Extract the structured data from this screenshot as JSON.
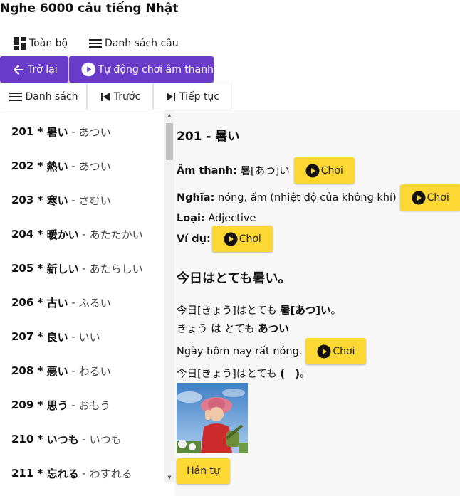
{
  "app": {
    "title": "Nghe 6000 câu tiếng Nhật"
  },
  "view_toggle": {
    "all_label": "Toàn bộ",
    "list_label": "Danh sách câu"
  },
  "nav": {
    "back_label": "Trở lại",
    "autoplay_label": "Tự động chơi âm thanh"
  },
  "tabs": {
    "list_label": "Danh sách",
    "prev_label": "Trước",
    "next_label": "Tiếp tục"
  },
  "sidebar": {
    "items": [
      {
        "num": "201",
        "kanji": "暑い",
        "kana": "あつい"
      },
      {
        "num": "202",
        "kanji": "熱い",
        "kana": "あつい"
      },
      {
        "num": "203",
        "kanji": "寒い",
        "kana": "さむい"
      },
      {
        "num": "204",
        "kanji": "暖かい",
        "kana": "あたたかい"
      },
      {
        "num": "205",
        "kanji": "新しい",
        "kana": "あたらしい"
      },
      {
        "num": "206",
        "kanji": "古い",
        "kana": "ふるい"
      },
      {
        "num": "207",
        "kanji": "良い",
        "kana": "いい"
      },
      {
        "num": "208",
        "kanji": "悪い",
        "kana": "わるい"
      },
      {
        "num": "209",
        "kanji": "思う",
        "kana": "おもう"
      },
      {
        "num": "210",
        "kanji": "いつも",
        "kana": "いつも"
      },
      {
        "num": "211",
        "kanji": "忘れる",
        "kana": "わすれる"
      }
    ]
  },
  "detail": {
    "heading": "201 - 暑い",
    "sound_label": "Âm thanh:",
    "sound_value": "暑[あつ]い",
    "meaning_label": "Nghĩa:",
    "meaning_value": "nóng, ấm (nhiệt độ của không khí)",
    "type_label": "Loại:",
    "type_value": "Adjective",
    "example_label": "Ví dụ:",
    "play_label": "Chơi",
    "example_sentence": "今日はとても暑い。",
    "furigana_plain": "今日[きょう]はとても ",
    "furigana_bold": "暑[あつ]い",
    "furigana_end": "。",
    "kana_plain": "きょう は とても ",
    "kana_bold": "あつい",
    "translation": "Ngày hôm nay rất nóng.",
    "cloze_plain": "今日[きょう]はとても ",
    "cloze_bold": "(　)",
    "cloze_end": "。",
    "kanji_button": "Hán tự"
  },
  "colors": {
    "accent_purple": "#6a3bc9",
    "play_yellow": "#fdd835",
    "panel_bg": "#f7f7f7"
  },
  "icons": {
    "all": "grid-icon",
    "list": "list-icon",
    "back": "arrow-left-icon",
    "autoplay": "play-circle-icon",
    "prev": "skip-previous-icon",
    "next": "skip-next-icon",
    "play": "play-circle-icon"
  }
}
